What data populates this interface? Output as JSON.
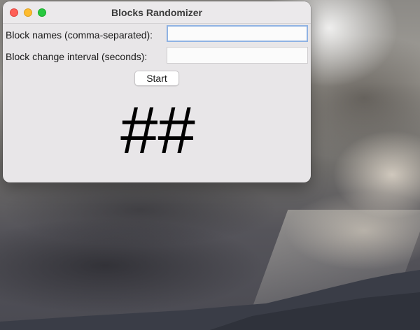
{
  "window": {
    "title": "Blocks Randomizer"
  },
  "form": {
    "block_names_label": "Block names (comma-separated):",
    "block_names_value": "",
    "interval_label": "Block change interval (seconds):",
    "interval_value": ""
  },
  "actions": {
    "start_label": "Start"
  },
  "display": {
    "current_block": "##"
  },
  "colors": {
    "close": "#fe5f57",
    "minimize": "#febc2e",
    "maximize": "#28c840",
    "focus_ring": "#8fb2e3"
  }
}
